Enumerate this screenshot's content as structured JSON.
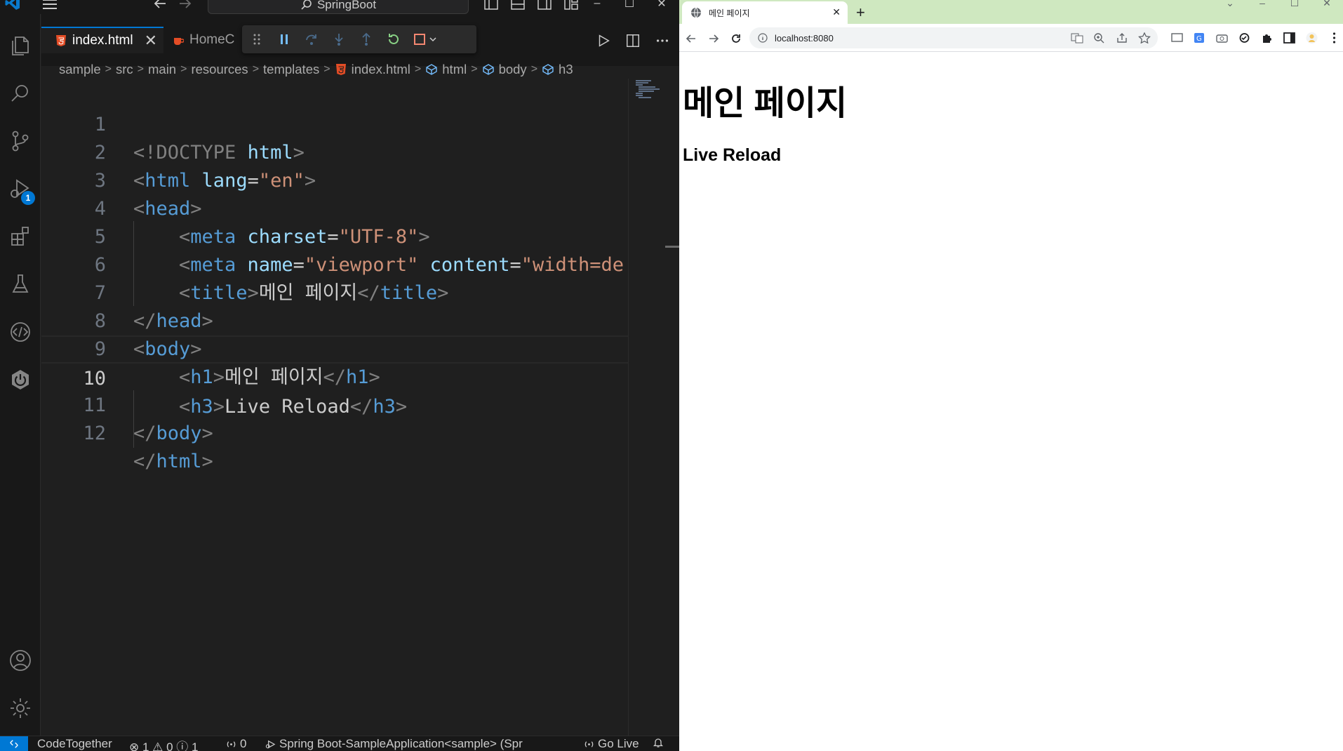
{
  "vscode": {
    "command_center": "SpringBoot",
    "window_controls": [
      "–",
      "☐",
      "✕"
    ],
    "tabs": [
      {
        "label": "index.html",
        "close": "✕"
      },
      {
        "label": "HomeC"
      }
    ],
    "breadcrumb": [
      "sample",
      "src",
      "main",
      "resources",
      "templates",
      "index.html",
      "html",
      "body",
      "h3"
    ],
    "activity_badge": "1",
    "code_lines": [
      {
        "n": "1"
      },
      {
        "n": "2"
      },
      {
        "n": "3"
      },
      {
        "n": "4"
      },
      {
        "n": "5"
      },
      {
        "n": "6"
      },
      {
        "n": "7"
      },
      {
        "n": "8"
      },
      {
        "n": "9"
      },
      {
        "n": "10"
      },
      {
        "n": "11"
      },
      {
        "n": "12"
      }
    ],
    "code": {
      "l1_doctype": "<!DOCTYPE",
      "l1_html": " html",
      "l1_close": ">",
      "l2_open": "<",
      "l2_tag": "html",
      "l2_attr": " lang",
      "l2_eq": "=",
      "l2_val": "\"en\"",
      "l2_close": ">",
      "l3_open": "<",
      "l3_tag": "head",
      "l3_close": ">",
      "l4_tag": "meta",
      "l4_attr": " charset",
      "l4_val": "\"UTF-8\"",
      "l5_tag": "meta",
      "l5_attr1": " name",
      "l5_val1": "\"viewport\"",
      "l5_attr2": " content",
      "l5_val2": "\"width=de",
      "l6_tag": "title",
      "l6_text": "메인 페이지",
      "l6_end": "title",
      "l7_tag": "head",
      "l8_tag": "body",
      "l9_tag": "h1",
      "l9_text": "메인 페이지",
      "l9_end": "h1",
      "l10_tag": "h3",
      "l10_text": "Live Reload",
      "l10_end": "h3",
      "l11_tag": "body",
      "l12_tag": "html"
    },
    "status": {
      "codetogether": "CodeTogether",
      "problems": "⊗ 1 ⚠ 0 ⓘ 1",
      "ports": "0",
      "run": "Spring Boot-SampleApplication<sample> (Spr",
      "golive": "Go Live"
    }
  },
  "chrome": {
    "tab_title": "메인 페이지",
    "tab_close": "✕",
    "new_tab": "+",
    "url": "localhost:8080",
    "page_h1": "메인 페이지",
    "page_h3": "Live Reload"
  }
}
